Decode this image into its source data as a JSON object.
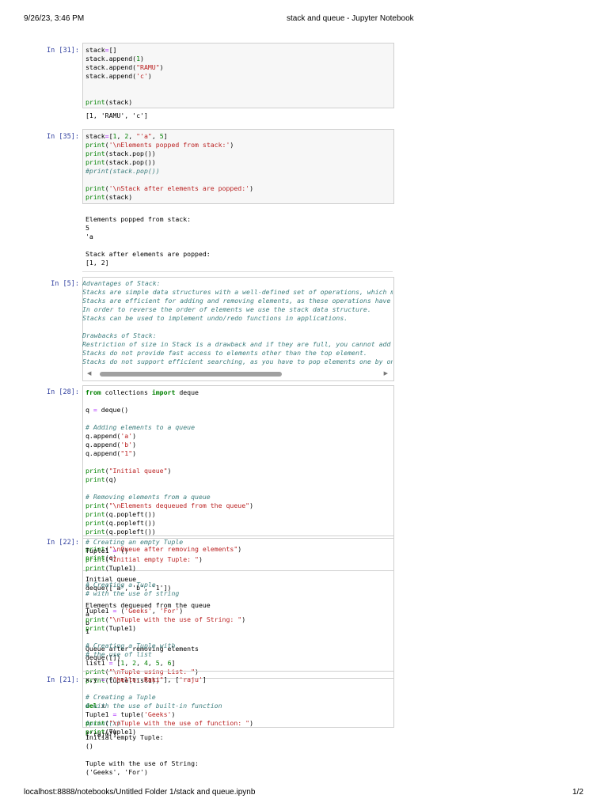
{
  "header": {
    "datetime": "9/26/23, 3:46 PM",
    "title": "stack and queue - Jupyter Notebook"
  },
  "footer": {
    "url": "localhost:8888/notebooks/Untitled Folder 1/stack and queue.ipynb",
    "page": "1/2"
  },
  "prompts": {
    "c31": "In [31]:",
    "c35": "In [35]:",
    "c5": "In [5]:",
    "c28": "In [28]:",
    "c22": "In [22]:",
    "c21": "In [21]:"
  },
  "colors": {
    "keyword": "#008000",
    "string": "#ba2121",
    "comment": "#408080",
    "prompt": "#303f9f",
    "operator": "#aa22ff"
  },
  "blocks": {
    "c31code": [
      [
        [
          "stack"
        ],
        [
          "=",
          "op"
        ],
        [
          "[]"
        ]
      ],
      [
        [
          "stack.append("
        ],
        [
          "1",
          "nu"
        ],
        [
          ")"
        ]
      ],
      [
        [
          "stack.append("
        ],
        [
          "\"RAMU\"",
          "st"
        ],
        [
          ")"
        ]
      ],
      [
        [
          "stack.append("
        ],
        [
          "'c'",
          "st"
        ],
        [
          ")"
        ]
      ],
      [],
      [],
      [
        [
          "print",
          "bi"
        ],
        [
          "(stack)"
        ]
      ]
    ],
    "c31out": [
      [
        [
          "[1, 'RAMU', 'c']"
        ]
      ]
    ],
    "c35code": [
      [
        [
          "stack"
        ],
        [
          "=",
          "op"
        ],
        [
          "["
        ],
        [
          "1",
          "nu"
        ],
        [
          ", "
        ],
        [
          "2",
          "nu"
        ],
        [
          ", "
        ],
        [
          "\"'a\"",
          "st"
        ],
        [
          ", "
        ],
        [
          "5",
          "nu"
        ],
        [
          "]"
        ]
      ],
      [
        [
          "print",
          "bi"
        ],
        [
          "("
        ],
        [
          "'\\nElements popped from stack:'",
          "st"
        ],
        [
          ")"
        ]
      ],
      [
        [
          "print",
          "bi"
        ],
        [
          "(stack.pop())"
        ]
      ],
      [
        [
          "print",
          "bi"
        ],
        [
          "(stack.pop())"
        ]
      ],
      [
        [
          "#print(stack.pop())",
          "cm"
        ]
      ],
      [],
      [
        [
          "print",
          "bi"
        ],
        [
          "("
        ],
        [
          "'\\nStack after elements are popped:'",
          "st"
        ],
        [
          ")"
        ]
      ],
      [
        [
          "print",
          "bi"
        ],
        [
          "(stack)"
        ]
      ]
    ],
    "c35out": [
      [
        [
          "Elements popped from stack:"
        ]
      ],
      [
        [
          "5"
        ]
      ],
      [
        [
          "'a"
        ]
      ],
      [],
      [
        [
          "Stack after elements are popped:"
        ]
      ],
      [
        [
          "[1, 2]"
        ]
      ]
    ],
    "c5code": [
      [
        [
          "Advantages of Stack:",
          "md"
        ]
      ],
      [
        [
          "Stacks are simple data structures with a well-defined set of operations, which mal",
          "md"
        ]
      ],
      [
        [
          "Stacks are efficient for adding and removing elements, as these operations have a",
          "md"
        ]
      ],
      [
        [
          "In order to reverse the order of elements we use the stack data structure.",
          "md"
        ]
      ],
      [
        [
          "Stacks can be used to implement undo/redo functions in applications.",
          "md"
        ]
      ],
      [],
      [
        [
          "Drawbacks of Stack:",
          "md"
        ]
      ],
      [
        [
          "Restriction of size in Stack is a drawback and if they are full, you cannot add ar",
          "md"
        ]
      ],
      [
        [
          "Stacks do not provide fast access to elements other than the top element.",
          "md"
        ]
      ],
      [
        [
          "Stacks do not support efficient searching, as you have to pop elements one by one",
          "md"
        ]
      ]
    ],
    "c28code": [
      [
        [
          "from",
          "kw"
        ],
        [
          " collections "
        ],
        [
          "import",
          "kw"
        ],
        [
          " deque"
        ]
      ],
      [],
      [
        [
          "q "
        ],
        [
          "=",
          "op"
        ],
        [
          " deque()"
        ]
      ],
      [],
      [
        [
          "# Adding elements to a queue",
          "cm"
        ]
      ],
      [
        [
          "q.append("
        ],
        [
          "'a'",
          "st"
        ],
        [
          ")"
        ]
      ],
      [
        [
          "q.append("
        ],
        [
          "'b'",
          "st"
        ],
        [
          ")"
        ]
      ],
      [
        [
          "q.append("
        ],
        [
          "\"1\"",
          "st"
        ],
        [
          ")"
        ]
      ],
      [],
      [
        [
          "print",
          "bi"
        ],
        [
          "("
        ],
        [
          "\"Initial queue\"",
          "st"
        ],
        [
          ")"
        ]
      ],
      [
        [
          "print",
          "bi"
        ],
        [
          "(q)"
        ]
      ],
      [],
      [
        [
          "# Removing elements from a queue",
          "cm"
        ]
      ],
      [
        [
          "print",
          "bi"
        ],
        [
          "("
        ],
        [
          "\"\\nElements dequeued from the queue\"",
          "st"
        ],
        [
          ")"
        ]
      ],
      [
        [
          "print",
          "bi"
        ],
        [
          "(q.popleft())"
        ]
      ],
      [
        [
          "print",
          "bi"
        ],
        [
          "(q.popleft())"
        ]
      ],
      [
        [
          "print",
          "bi"
        ],
        [
          "(q.popleft())"
        ]
      ],
      [],
      [
        [
          "print",
          "bi"
        ],
        [
          "("
        ],
        [
          "\"\\nQueue after removing elements\"",
          "st"
        ],
        [
          ")"
        ]
      ],
      [
        [
          "print",
          "bi"
        ],
        [
          "(q)"
        ]
      ]
    ],
    "c28out": [
      [
        [
          "Initial queue"
        ]
      ],
      [
        [
          "deque(['a', 'b', '1'])"
        ]
      ],
      [],
      [
        [
          "Elements dequeued from the queue"
        ]
      ],
      [
        [
          "a"
        ]
      ],
      [
        [
          "b"
        ]
      ],
      [
        [
          "1"
        ]
      ],
      [],
      [
        [
          "Queue after removing elements"
        ]
      ],
      [
        [
          "deque([])"
        ]
      ]
    ],
    "c22code": [
      [
        [
          "# Creating an empty Tuple",
          "cm"
        ]
      ],
      [
        [
          "Tuple1 "
        ],
        [
          "=",
          "op"
        ],
        [
          " ()"
        ]
      ],
      [
        [
          "print",
          "bi"
        ],
        [
          "("
        ],
        [
          "\"Initial empty Tuple: \"",
          "st"
        ],
        [
          ")"
        ]
      ],
      [
        [
          "print",
          "bi"
        ],
        [
          "(Tuple1)"
        ]
      ]
    ],
    "c22rest": [
      [
        [
          "# Creating a Tuple",
          "cm"
        ]
      ],
      [
        [
          "# with the use of string",
          "cm"
        ]
      ],
      [],
      [
        [
          "Tuple1 "
        ],
        [
          "=",
          "op"
        ],
        [
          " ("
        ],
        [
          "'Geeks'",
          "st"
        ],
        [
          ", "
        ],
        [
          "'For'",
          "st"
        ],
        [
          ")"
        ]
      ],
      [
        [
          "print",
          "bi"
        ],
        [
          "("
        ],
        [
          "\"\\nTuple with the use of String: \"",
          "st"
        ],
        [
          ")"
        ]
      ],
      [
        [
          "print",
          "bi"
        ],
        [
          "(Tuple1)"
        ]
      ],
      [],
      [
        [
          "# Creating a Tuple with",
          "cm"
        ]
      ],
      [
        [
          "# the use of list",
          "cm"
        ]
      ],
      [
        [
          "list1 "
        ],
        [
          "=",
          "op"
        ],
        [
          " ["
        ],
        [
          "1",
          "nu"
        ],
        [
          ", "
        ],
        [
          "2",
          "nu"
        ],
        [
          ", "
        ],
        [
          "4",
          "nu"
        ],
        [
          ", "
        ],
        [
          "5",
          "nu"
        ],
        [
          ", "
        ],
        [
          "6",
          "nu"
        ],
        [
          "]"
        ]
      ],
      [
        [
          "print",
          "bi"
        ],
        [
          "("
        ],
        [
          "\"\\nTuple using List: \"",
          "st"
        ],
        [
          ")"
        ]
      ],
      [
        [
          "print",
          "bi"
        ],
        [
          "(tuple(list1))"
        ]
      ]
    ],
    "c21code": [
      [
        [
          "x,y "
        ],
        [
          "=",
          "op"
        ],
        [
          " ["
        ],
        [
          "\"hello, Raki\"",
          "st"
        ],
        [
          "], ["
        ],
        [
          "'raju'",
          "st"
        ],
        [
          "]"
        ]
      ],
      [],
      [
        [
          "# Creating a Tuple",
          "cm"
        ]
      ],
      [
        [
          "del",
          "kw"
        ],
        [
          " x"
        ]
      ],
      [],
      [
        [
          "#print(x)",
          "cm"
        ]
      ],
      [
        [
          "print",
          "bi"
        ],
        [
          "(y)"
        ]
      ]
    ],
    "c21over": [
      [],
      [],
      [],
      [
        [
          "# with the use of built-in function",
          "cm"
        ]
      ],
      [
        [
          "Tuple1 "
        ],
        [
          "=",
          "op"
        ],
        [
          " tuple("
        ],
        [
          "'Geeks'",
          "st"
        ],
        [
          ")"
        ]
      ],
      [
        [
          "print",
          "bi"
        ],
        [
          "("
        ],
        [
          "\"\\nTuple with the use of function: \"",
          "st"
        ],
        [
          ")"
        ]
      ],
      [
        [
          "print",
          "bi"
        ],
        [
          "(Tuple1)"
        ]
      ]
    ],
    "c21out": [
      [
        [
          "['raju']"
        ]
      ]
    ],
    "c22out": [
      [
        [
          "Initial empty Tuple:"
        ]
      ],
      [
        [
          "()"
        ]
      ],
      [],
      [
        [
          "Tuple with the use of String:"
        ]
      ],
      [
        [
          "('Geeks', 'For')"
        ]
      ]
    ]
  }
}
